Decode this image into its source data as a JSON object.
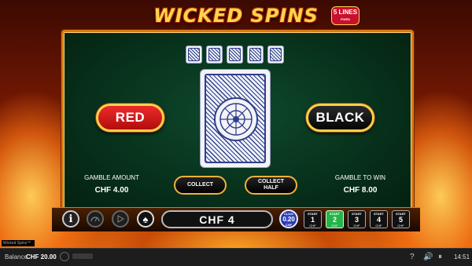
{
  "logo": {
    "text": "WICKED SPINS",
    "badge_big": "5 LINES",
    "badge_small": "FIXED"
  },
  "gamble": {
    "history_count": 5,
    "red_label": "RED",
    "black_label": "BLACK",
    "gamble_amount_label": "GAMBLE AMOUNT",
    "gamble_amount_value": "CHF 4.00",
    "gamble_to_win_label": "GAMBLE TO WIN",
    "gamble_to_win_value": "CHF 8.00",
    "collect_label": "COLLECT",
    "collect_half_label": "COLLECT HALF"
  },
  "toolbar": {
    "info_glyph": "i",
    "spade_glyph": "♠",
    "win_display": "CHF 4",
    "coin_top": "CLICK",
    "coin_value": "0.20",
    "coin_bottom": "CHF",
    "starts": [
      {
        "label": "START",
        "num": "1",
        "unit": "CHF",
        "active": false
      },
      {
        "label": "START",
        "num": "2",
        "unit": "CHF",
        "active": true
      },
      {
        "label": "START",
        "num": "3",
        "unit": "CHF",
        "active": false
      },
      {
        "label": "START",
        "num": "4",
        "unit": "CHF",
        "active": false
      },
      {
        "label": "START",
        "num": "5",
        "unit": "CHF",
        "active": false
      }
    ]
  },
  "tagline": "Wicked Spins™",
  "status": {
    "balance_label": "Balance",
    "balance_value": "CHF 20.00",
    "help_icon": "?",
    "sound_icon": "🔊",
    "pause_icon": "⏸",
    "time": "14:51"
  },
  "colors": {
    "accent": "#ffcf4d",
    "felt": "#07301b",
    "active_start": "#25b34a",
    "red_button": "#d61a1a"
  }
}
